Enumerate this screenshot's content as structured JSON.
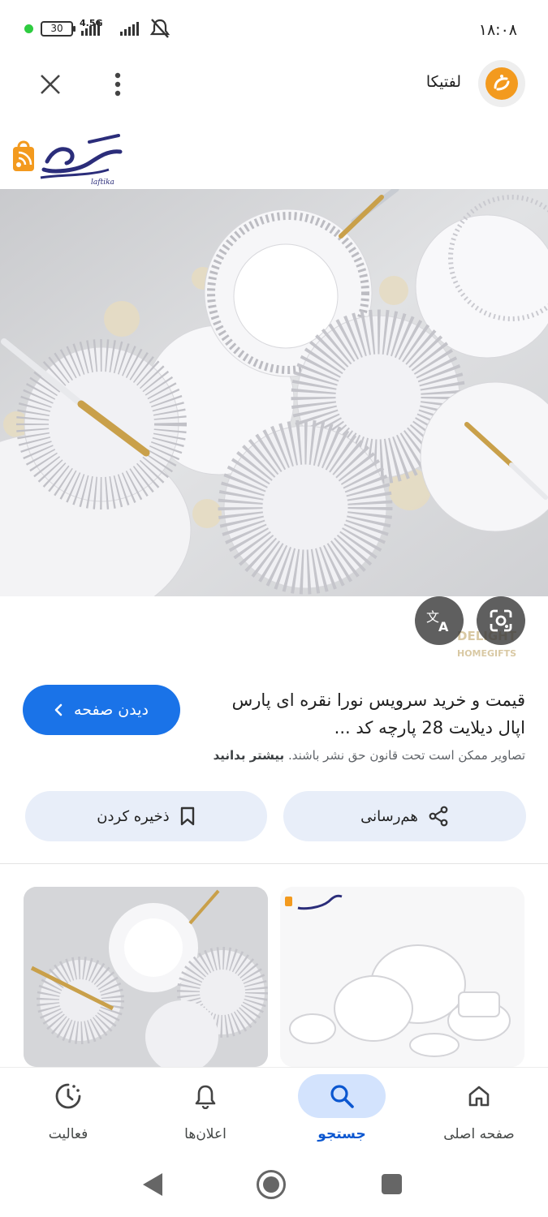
{
  "status_bar": {
    "battery": "30",
    "network": "4.5G",
    "time": "۱۸:۰۸"
  },
  "top_bar": {
    "site_name": "لفتیکا"
  },
  "preview": {
    "brand_logo_text": "لفتیکا",
    "brand_logo_subtext": "laftika",
    "watermark_text": "DELIGHT HOMEGIFTS"
  },
  "result": {
    "visit_label": "دیدن صفحه",
    "title": "قیمت و خرید سرویس نورا نقره ای پارس اپال دیلایت 28 پارچه کد ...",
    "copyright_text": "تصاویر ممکن است تحت قانون حق نشر باشند.",
    "learn_more": "بیشتر بدانید",
    "share_label": "هم‌رسانی",
    "save_label": "ذخیره کردن"
  },
  "bottom_nav": {
    "home": "صفحه اصلی",
    "search": "جستجو",
    "notifications": "اعلان‌ها",
    "activity": "فعالیت"
  },
  "colors": {
    "primary_blue": "#1a73e8",
    "tonal_button": "#e8eef9",
    "active_nav": "#d3e3fd",
    "brand_orange": "#f39a1e",
    "brand_navy": "#2b2d7a"
  }
}
